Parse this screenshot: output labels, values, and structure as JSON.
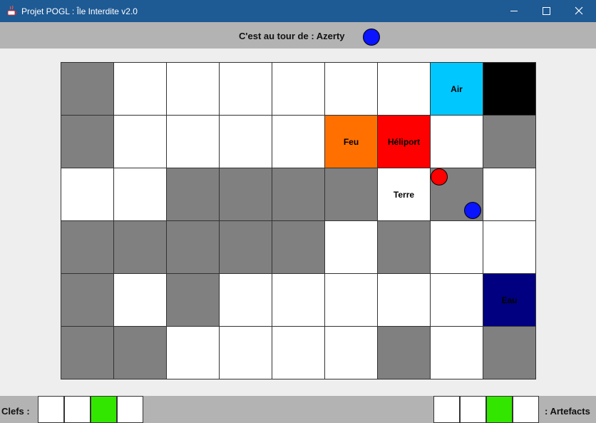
{
  "window": {
    "title": "Projet POGL : Île Interdite v2.0",
    "titlebar_color": "#1e5a94"
  },
  "turn": {
    "text": "C'est au tour de : Azerty",
    "token_color": "#0a14ff"
  },
  "board": {
    "rows": 6,
    "cols": 9,
    "colors": {
      "dry": "#ffffff",
      "flooded": "#808080",
      "sunk": "#000000"
    },
    "grid": [
      [
        "flooded",
        "dry",
        "dry",
        "dry",
        "dry",
        "dry",
        "dry",
        "air",
        "sunk"
      ],
      [
        "flooded",
        "dry",
        "dry",
        "dry",
        "dry",
        "fire",
        "heliport",
        "dry",
        "flooded"
      ],
      [
        "dry",
        "dry",
        "flooded",
        "flooded",
        "flooded",
        "flooded",
        "earth",
        "flooded",
        "dry"
      ],
      [
        "flooded",
        "flooded",
        "flooded",
        "flooded",
        "flooded",
        "dry",
        "flooded",
        "dry",
        "dry"
      ],
      [
        "flooded",
        "dry",
        "flooded",
        "dry",
        "dry",
        "dry",
        "dry",
        "dry",
        "water"
      ],
      [
        "flooded",
        "flooded",
        "dry",
        "dry",
        "dry",
        "dry",
        "flooded",
        "dry",
        "flooded"
      ]
    ],
    "special_tiles": {
      "air": {
        "label": "Air",
        "color": "#00c8ff"
      },
      "fire": {
        "label": "Feu",
        "color": "#ff7000"
      },
      "heliport": {
        "label": "Héliport",
        "color": "#ff0000"
      },
      "earth": {
        "label": "Terre",
        "color": "#ffffff"
      },
      "water": {
        "label": "Eau",
        "color": "#000080"
      }
    },
    "players": [
      {
        "color": "#ff0000",
        "row": 2,
        "col": 7,
        "corner": "top-left"
      },
      {
        "color": "#0a14ff",
        "row": 2,
        "col": 7,
        "corner": "bottom-right"
      }
    ]
  },
  "inventory": {
    "keys_label": "Clefs :",
    "artifacts_label": ": Artefacts",
    "key_slots": [
      "#ffffff",
      "#ffffff",
      "#33e600",
      "#ffffff"
    ],
    "artifact_slots": [
      "#ffffff",
      "#ffffff",
      "#33e600",
      "#ffffff"
    ]
  }
}
